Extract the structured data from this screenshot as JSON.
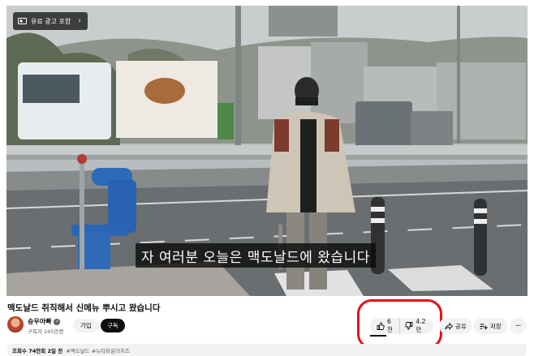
{
  "video": {
    "paid_badge": "유료 광고 포함",
    "subtitle": "자 여러분 오늘은 맥도날드에 왔습니다"
  },
  "title": "맥도날드 취직해서 신메뉴 뿌시고 왔습니다",
  "channel": {
    "name": "승우아빠",
    "subscribers": "구독자 165만명",
    "join_label": "가입",
    "subscribe_label": "구독"
  },
  "actions": {
    "likes": "6천",
    "dislikes": "4.2만",
    "share_label": "공유",
    "save_label": "저장",
    "more_label": "···"
  },
  "description": {
    "views_date": "조회수 74만회 2일 전",
    "tags": "#맥도날드 #뉴타파운더치즈"
  },
  "colors": {
    "highlight": "#e3121a",
    "subscribe_bg": "#0f0f0f",
    "pill_bg": "#f2f2f2"
  },
  "icons": [
    "ad-badge-icon",
    "chevron-right-icon",
    "verified-icon",
    "thumbs-up-icon",
    "thumbs-down-icon",
    "share-icon",
    "save-icon",
    "more-icon"
  ]
}
